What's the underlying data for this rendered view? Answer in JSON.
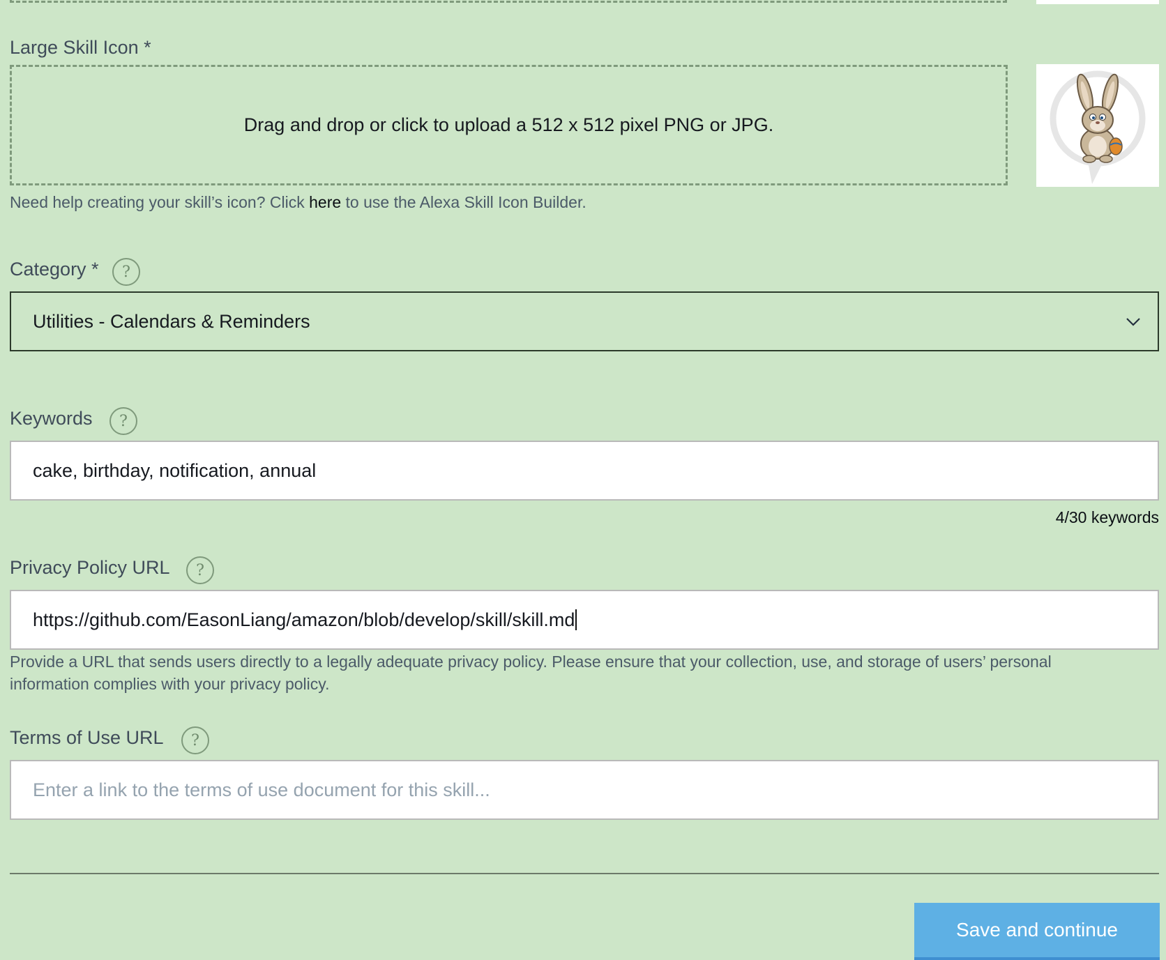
{
  "large_icon": {
    "label": "Large Skill Icon *",
    "dropzone_text": "Drag and drop or click to upload a 512 x 512 pixel PNG or JPG.",
    "help_prefix": "Need help creating your skill’s icon? Click ",
    "help_link": "here",
    "help_suffix": " to use the Alexa Skill Icon Builder."
  },
  "category": {
    "label": "Category *",
    "help_glyph": "?",
    "selected": "Utilities - Calendars & Reminders",
    "caret_icon": "chevron-down-icon"
  },
  "keywords": {
    "label": "Keywords",
    "help_glyph": "?",
    "value": "cake, birthday, notification, annual",
    "count": "4/30 keywords"
  },
  "privacy": {
    "label": "Privacy Policy URL",
    "help_glyph": "?",
    "value": "https://github.com/EasonLiang/amazon/blob/develop/skill/skill.md",
    "help_line1": "Provide a URL that sends users directly to a legally adequate privacy policy. Please ensure that your collection, use, and storage of users’ personal",
    "help_line2": "information complies with your privacy policy."
  },
  "terms": {
    "label": "Terms of Use URL",
    "help_glyph": "?",
    "placeholder": "Enter a link to the terms of use document for this skill..."
  },
  "actions": {
    "save_label": "Save and continue"
  },
  "colors": {
    "background": "#cde6c8",
    "primary_button": "#5eb0e4"
  }
}
